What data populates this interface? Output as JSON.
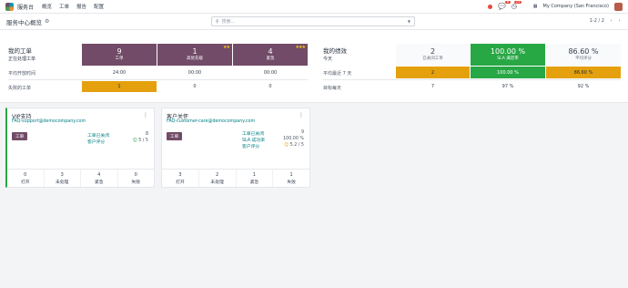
{
  "nav": {
    "app_name": "服务台",
    "menu": [
      "概览",
      "工单",
      "报告",
      "配置"
    ],
    "chat_badge": "8",
    "activity_badge": "21",
    "company": "My Company (San Francisco)"
  },
  "control": {
    "breadcrumb": "服务中心概览",
    "search_placeholder": "搜索...",
    "pager": "1-2 / 2"
  },
  "my_tickets": {
    "title": "我的工单",
    "subtitle": "正在处理工单",
    "headers": [
      {
        "value": "9",
        "label": "工单",
        "stars": ""
      },
      {
        "value": "1",
        "label": "高优先级",
        "stars": "★★"
      },
      {
        "value": "4",
        "label": "紧急",
        "stars": "★★★"
      }
    ],
    "rows": [
      {
        "label": "平均开放时间",
        "values": [
          "24:00",
          "00:00",
          "00:00"
        ]
      },
      {
        "label": "失败的工单",
        "values": [
          "1",
          "0",
          "0"
        ]
      }
    ]
  },
  "my_performance": {
    "title": "我的绩效",
    "subtitle": "今天",
    "headers": [
      {
        "value": "2",
        "label": "已关闭工单"
      },
      {
        "value": "100.00 %",
        "label": "SLA 满足率"
      },
      {
        "value": "86.60 %",
        "label": "平均评分"
      }
    ],
    "rows": [
      {
        "label": "平均最近 7 天",
        "values": [
          "2",
          "100.00 %",
          "86.60 %"
        ]
      },
      {
        "label": "目标每天",
        "values": [
          "7",
          "97 %",
          "92 %"
        ]
      }
    ]
  },
  "teams": [
    {
      "name": "VIP支持",
      "email": "FAQ-support@democompany.com",
      "button": "工单",
      "stats": [
        {
          "label": "工单已关闭",
          "value": "8"
        },
        {
          "label": "客户评分",
          "value": "5 / 5"
        }
      ],
      "footer": [
        {
          "count": "0",
          "label": "打开"
        },
        {
          "count": "3",
          "label": "未处理"
        },
        {
          "count": "4",
          "label": "紧急"
        },
        {
          "count": "0",
          "label": "失败"
        }
      ]
    },
    {
      "name": "客户关怀",
      "email": "FAQ-customer-care@democompany.com",
      "button": "工单",
      "stats": [
        {
          "label": "工单已关闭",
          "value": "9"
        },
        {
          "label": "SLA 成功率",
          "value": "100.00 %"
        },
        {
          "label": "客户评分",
          "value": "5.2 / 5"
        }
      ],
      "footer": [
        {
          "count": "3",
          "label": "打开"
        },
        {
          "count": "2",
          "label": "未处理"
        },
        {
          "count": "1",
          "label": "紧急"
        },
        {
          "count": "1",
          "label": "失败"
        }
      ]
    }
  ],
  "colors": {
    "brand_purple": "#714b67",
    "success_green": "#28a745",
    "warning_amber": "#e5a00d",
    "link_teal": "#017e84"
  }
}
